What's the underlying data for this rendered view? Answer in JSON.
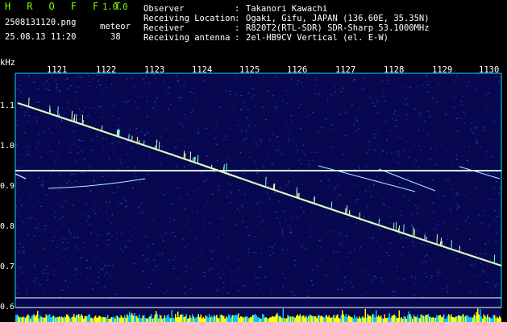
{
  "app": {
    "name": "H R O F F T",
    "version": "1.0.0"
  },
  "file": {
    "name": "2508131120.png",
    "timestamp": "25.08.13 11:20"
  },
  "meteor": {
    "label": "meteor",
    "count": "38"
  },
  "info": [
    {
      "label": "Observer",
      "sep": ":",
      "value": "Takanori Kawachi"
    },
    {
      "label": "Receiving Location",
      "sep": ":",
      "value": "Ogaki, Gifu, JAPAN (136.60E, 35.35N)"
    },
    {
      "label": "Receiver",
      "sep": ":",
      "value": "R820T2(RTL-SDR) SDR-Sharp 53.1000MHz"
    },
    {
      "label": "Receiving antenna",
      "sep": ":",
      "value": "2el-HB9CV Vertical (el. E-W)"
    }
  ],
  "plot": {
    "y_unit": "kHz",
    "x_ticks": [
      "1121",
      "1122",
      "1123",
      "1124",
      "1125",
      "1126",
      "1127",
      "1128",
      "1129",
      "1130"
    ],
    "y_ticks": [
      "1.1",
      "1.0",
      "0.9",
      "0.8",
      "0.7",
      "0.6"
    ]
  },
  "colors": {
    "accent_green": "#7CFC00",
    "text_white": "#ffffff",
    "bg": "#0a0a5a",
    "trace": "#d8ffb0",
    "baseline": "#ffff00",
    "axis_cyan": "#00e0ff"
  }
}
